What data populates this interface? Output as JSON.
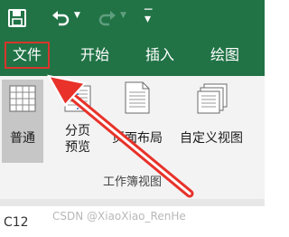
{
  "ribbon_tabs": [
    "文件",
    "开始",
    "插入",
    "绘图"
  ],
  "view_buttons": [
    "普通",
    "分页\n预览",
    "页面布局",
    "自定义视图"
  ],
  "group_label": "工作簿视图",
  "name_box": "C12",
  "watermark": "CSDN @XiaoXiao_RenHe",
  "colors": {
    "ribbon_green": "#217346",
    "highlight_red": "#d9352c",
    "arrow_red": "#e8322a"
  },
  "icons": [
    "save-icon",
    "undo-icon",
    "redo-icon",
    "qat-customize-icon",
    "normal-view-icon",
    "page-break-preview-icon",
    "page-layout-icon",
    "custom-views-icon"
  ]
}
